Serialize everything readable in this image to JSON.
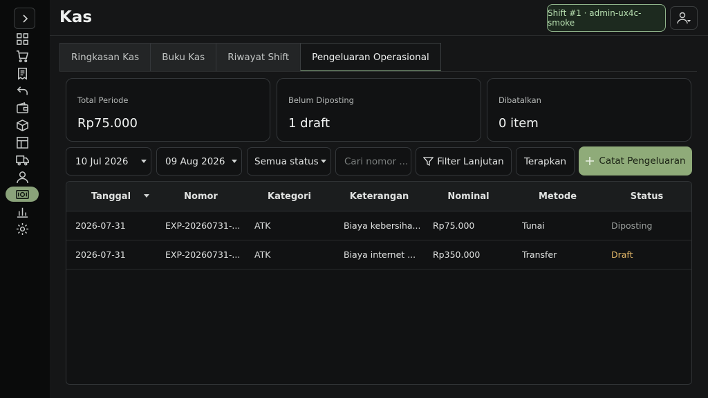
{
  "page": {
    "title": "Kas"
  },
  "header": {
    "shift_badge": "Shift #1 · admin-ux4c-smoke"
  },
  "sidebar": {
    "icons": [
      "chevron-right-icon",
      "dashboard-grid-icon",
      "cart-icon",
      "receipt-icon",
      "undo-icon",
      "wallet-icon",
      "box-icon",
      "table-icon",
      "truck-icon",
      "user-icon",
      "cash-icon",
      "bar-chart-icon",
      "gear-icon"
    ],
    "active": "cash-icon"
  },
  "tabs": [
    {
      "label": "Ringkasan Kas"
    },
    {
      "label": "Buku Kas"
    },
    {
      "label": "Riwayat Shift"
    },
    {
      "label": "Pengeluaran Operasional"
    }
  ],
  "cards": [
    {
      "label": "Total Periode",
      "value": "Rp75.000"
    },
    {
      "label": "Belum Diposting",
      "value": "1 draft"
    },
    {
      "label": "Dibatalkan",
      "value": "0 item"
    }
  ],
  "filters": {
    "date_from": "10 Jul 2026",
    "date_to": "09 Aug 2026",
    "status": "Semua status",
    "search_placeholder": "Cari nomor ...",
    "advanced_filter": "Filter Lanjutan",
    "apply": "Terapkan",
    "add_expense": "Catat Pengeluaran"
  },
  "table": {
    "columns": [
      "Tanggal",
      "Nomor",
      "Kategori",
      "Keterangan",
      "Nominal",
      "Metode",
      "Status"
    ],
    "rows": [
      {
        "tanggal": "2026-07-31",
        "nomor": "EXP-20260731-...",
        "kategori": "ATK",
        "keterangan": "Biaya kebersiha...",
        "nominal": "Rp75.000",
        "metode": "Tunai",
        "status": "Diposting"
      },
      {
        "tanggal": "2026-07-31",
        "nomor": "EXP-20260731-...",
        "kategori": "ATK",
        "keterangan": "Biaya internet ...",
        "nominal": "Rp350.000",
        "metode": "Transfer",
        "status": "Draft"
      }
    ]
  },
  "colors": {
    "accent": "#8fab79",
    "draft": "#e2b768",
    "posted": "#9a9e9c"
  }
}
